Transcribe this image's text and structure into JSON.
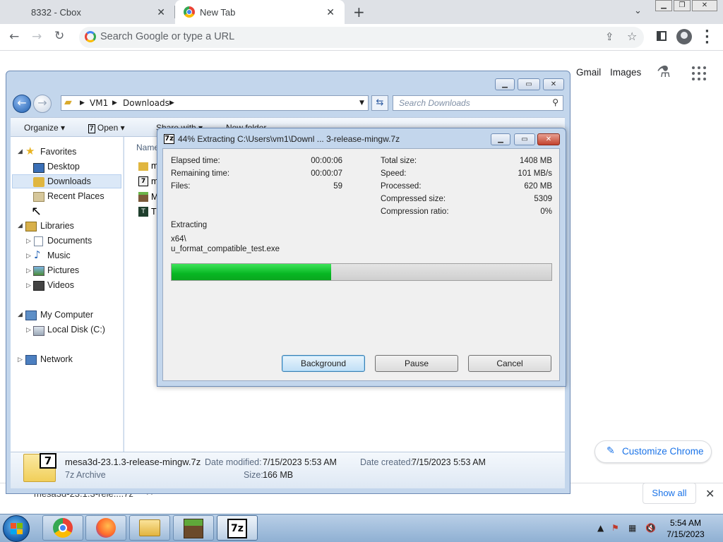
{
  "browser": {
    "tabs": [
      {
        "title": "8332 - Cbox",
        "active": false
      },
      {
        "title": "New Tab",
        "active": true
      }
    ],
    "omnibox_placeholder": "Search Google or type a URL",
    "ntp": {
      "links": [
        "Gmail",
        "Images"
      ],
      "customize_label": "Customize Chrome"
    },
    "download_shelf": {
      "item": "mesa3d-23.1.3-rele....7z",
      "show_all": "Show all"
    }
  },
  "explorer": {
    "breadcrumb": [
      "VM1",
      "Downloads"
    ],
    "search_placeholder": "Search Downloads",
    "commands": [
      "Organize",
      "Open",
      "Share with",
      "New folder"
    ],
    "column_header": "Name",
    "nav": {
      "favorites": "Favorites",
      "favorites_items": [
        "Desktop",
        "Downloads",
        "Recent Places"
      ],
      "libraries": "Libraries",
      "libraries_items": [
        "Documents",
        "Music",
        "Pictures",
        "Videos"
      ],
      "computer": "My Computer",
      "computer_items": [
        "Local Disk (C:)"
      ],
      "network": "Network",
      "selected": "Downloads"
    },
    "file_rows": [
      "m",
      "m",
      "M",
      "T"
    ],
    "details": {
      "filename": "mesa3d-23.1.3-release-mingw.7z",
      "filetype": "7z Archive",
      "date_modified_label": "Date modified:",
      "date_modified": "7/15/2023 5:53 AM",
      "date_created_label": "Date created:",
      "date_created": "7/15/2023 5:53 AM",
      "size_label": "Size:",
      "size": "166 MB"
    }
  },
  "dialog": {
    "title": "44% Extracting C:\\Users\\vm1\\Downl ... 3-release-mingw.7z",
    "percent": 44,
    "left": [
      {
        "label": "Elapsed time:",
        "value": "00:00:06"
      },
      {
        "label": "Remaining time:",
        "value": "00:00:07"
      },
      {
        "label": "Files:",
        "value": "59"
      }
    ],
    "right": [
      {
        "label": "Total size:",
        "value": "1408 MB"
      },
      {
        "label": "Speed:",
        "value": "101 MB/s"
      },
      {
        "label": "Processed:",
        "value": "620 MB"
      },
      {
        "label": "Compressed size:",
        "value": "5309"
      },
      {
        "label": "Compression ratio:",
        "value": "0%"
      }
    ],
    "status": "Extracting",
    "path_line1": "x64\\",
    "path_line2": "u_format_compatible_test.exe",
    "progress": 0.42,
    "buttons": {
      "background": "Background",
      "pause": "Pause",
      "cancel": "Cancel"
    }
  },
  "taskbar": {
    "time": "5:54 AM",
    "date": "7/15/2023"
  },
  "colors": {
    "progress_green": "#07b723",
    "chrome_blue": "#1a73e8",
    "taskbar": "#8fb0d3"
  }
}
